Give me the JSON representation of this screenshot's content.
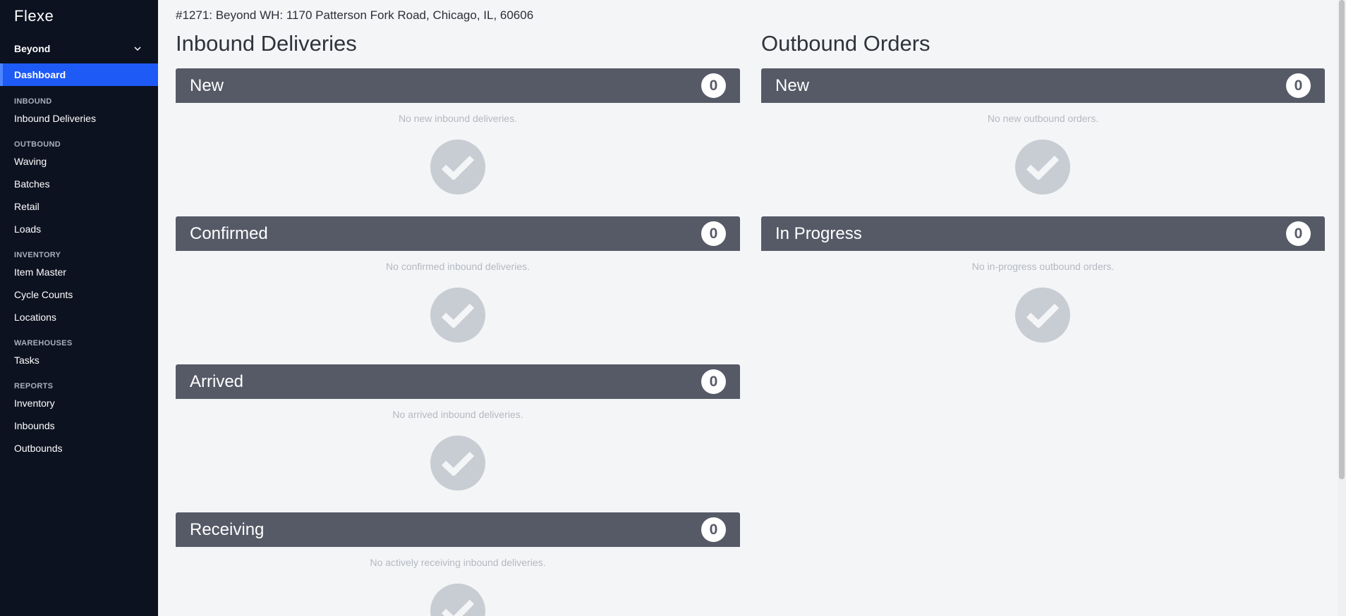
{
  "sidebar": {
    "logo": "Flexe",
    "org_selector": "Beyond",
    "active_item": "Dashboard",
    "sections": {
      "inbound": {
        "header": "INBOUND",
        "items": [
          "Inbound Deliveries"
        ]
      },
      "outbound": {
        "header": "OUTBOUND",
        "items": [
          "Waving",
          "Batches",
          "Retail",
          "Loads"
        ]
      },
      "inventory": {
        "header": "INVENTORY",
        "items": [
          "Item Master",
          "Cycle Counts",
          "Locations"
        ]
      },
      "warehouses": {
        "header": "WAREHOUSES",
        "items": [
          "Tasks"
        ]
      },
      "reports": {
        "header": "REPORTS",
        "items": [
          "Inventory",
          "Inbounds",
          "Outbounds"
        ]
      }
    }
  },
  "main": {
    "heading": "#1271: Beyond WH: 1170 Patterson Fork Road, Chicago, IL, 60606",
    "inbound": {
      "title": "Inbound Deliveries",
      "panels": [
        {
          "title": "New",
          "count": "0",
          "message": "No new inbound deliveries."
        },
        {
          "title": "Confirmed",
          "count": "0",
          "message": "No confirmed inbound deliveries."
        },
        {
          "title": "Arrived",
          "count": "0",
          "message": "No arrived inbound deliveries."
        },
        {
          "title": "Receiving",
          "count": "0",
          "message": "No actively receiving inbound deliveries."
        }
      ]
    },
    "outbound": {
      "title": "Outbound Orders",
      "panels": [
        {
          "title": "New",
          "count": "0",
          "message": "No new outbound orders."
        },
        {
          "title": "In Progress",
          "count": "0",
          "message": "No in-progress outbound orders."
        }
      ]
    }
  },
  "colors": {
    "sidebar_bg": "#0c1220",
    "active_nav": "#1e5af5",
    "panel_bar": "#565a67",
    "page_bg": "#f4f5f7",
    "check_circle": "#c8ccd3"
  },
  "icons": {
    "org_chevron": "chevron-down-icon",
    "empty_state": "checkmark-icon"
  }
}
